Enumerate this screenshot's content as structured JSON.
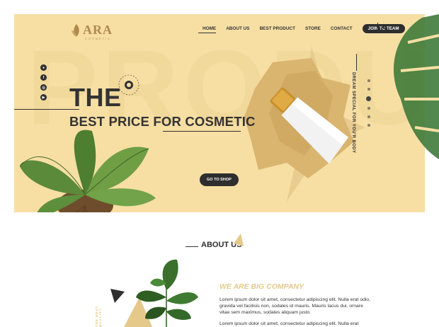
{
  "brand": {
    "name": "ARA",
    "tagline": "COSMETIC",
    "color": "#b08a4c"
  },
  "nav": {
    "items": [
      "HOME",
      "ABOUT US",
      "BEST PRODUCT",
      "STORE",
      "CONTACT"
    ],
    "active": "HOME",
    "join_label": "JOIN TO TEAM",
    "close_icon": "close-icon"
  },
  "social": {
    "icons": [
      "user-icon",
      "facebook-icon",
      "instagram-icon",
      "youtube-icon"
    ]
  },
  "hero": {
    "watermark": "PRODU",
    "title_line1": "THE",
    "title_line2": "BEST PRICE FOR COSMETIC",
    "cta_label": "GO TO SHOP",
    "vertical_text": "DREAM SPECIAL FOR YOU'R BODY",
    "slider_dots": 6,
    "slider_active_index": 2,
    "background_color": "#f7dfa4",
    "accent_color": "#e4c98a"
  },
  "about": {
    "section_title": "ABOUT US",
    "company_heading": "WE ARE BIG COMPANY",
    "paragraph1": "Lorem ipsum dolor sit amet, consectetur adipiscing elit. Nulla erat odio, gravida vel facilisis non, sodales id mauris. Mauris lacus dui, ornare vitae sem maximus, sodales aliquam justo.",
    "paragraph2": "Lorem ipsum dolor sit amet, consectetur adipiscing elit. Nulla erat",
    "side_text": "THE BEST QUALITY"
  }
}
